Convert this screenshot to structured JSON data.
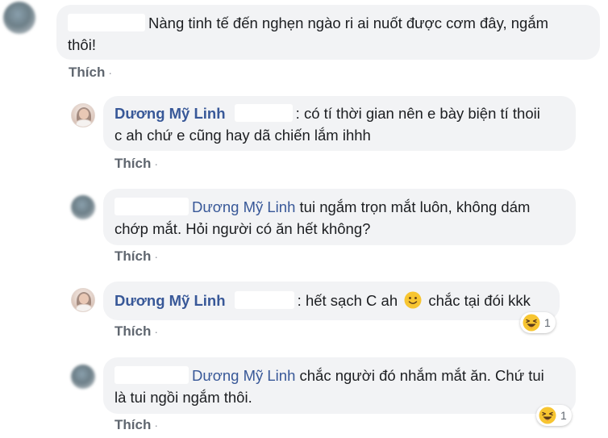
{
  "comments": [
    {
      "author": "",
      "text_line1": "Nàng tinh tế đến nghẹn ngào ri ai nuốt được cơm đây, ngắm",
      "text_line2": "thôi!",
      "action": "Thích"
    },
    {
      "author": "Dương Mỹ Linh",
      "text_line1": ": có tí thời gian nên e bày biện tí thoii",
      "text_line2": "c ah chứ e cũng hay dã chiến lắm ihhh",
      "action": "Thích"
    },
    {
      "mention": "Dương Mỹ Linh",
      "text_line1": " tui ngắm trọn mắt luôn, không dám",
      "text_line2": "chớp mắt. Hỏi người có ăn hết không?",
      "action": "Thích"
    },
    {
      "author": "Dương Mỹ Linh",
      "text_before_emoji": ": hết sạch C ah",
      "text_after_emoji": "chắc tại đói kkk",
      "emoji": "slightly-smiling-face",
      "action": "Thích",
      "reaction": {
        "icon": "haha-icon",
        "count": "1"
      }
    },
    {
      "mention": "Dương Mỹ Linh",
      "text_line1": " chắc người đó nhắm mắt ăn. Chứ tui",
      "text_line2": "là tui ngồi ngắm thôi.",
      "action": "Thích",
      "reaction": {
        "icon": "haha-icon",
        "count": "1"
      }
    }
  ],
  "colors": {
    "bubble": "#f2f3f5",
    "name": "#385898",
    "action": "#606770"
  }
}
